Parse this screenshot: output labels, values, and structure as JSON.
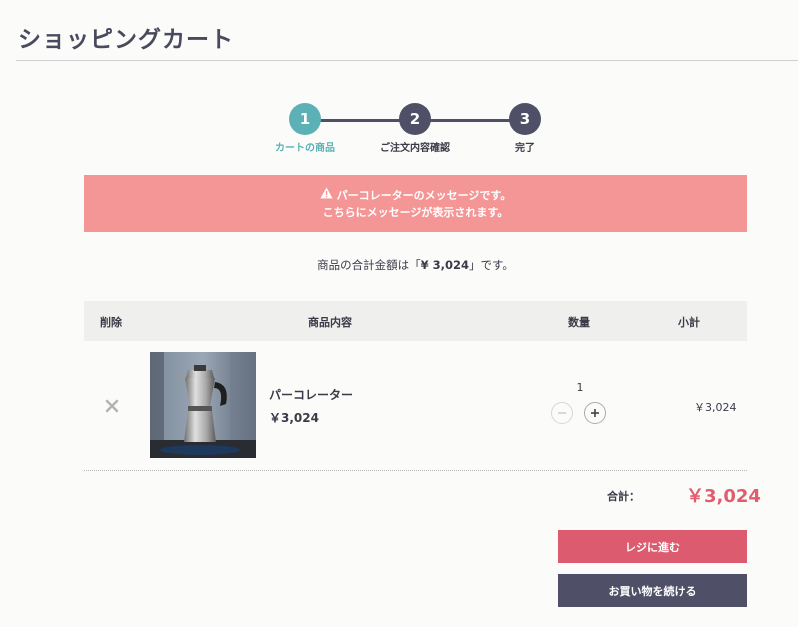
{
  "page": {
    "title": "ショッピングカート"
  },
  "steps": [
    {
      "number": "1",
      "label": "カートの商品",
      "active": true
    },
    {
      "number": "2",
      "label": "ご注文内容確認",
      "active": false
    },
    {
      "number": "3",
      "label": "完了",
      "active": false
    }
  ],
  "colors": {
    "active_step": "#5bb1b5",
    "inactive_step": "#4f4f68",
    "alert_bg": "#f59696",
    "accent_red": "#e25c6c"
  },
  "alert": {
    "icon": "warning-icon",
    "line1": "パーコレーターのメッセージです。",
    "line2": "こちらにメッセージが表示されます。"
  },
  "summary_text": {
    "prefix": "商品の合計金額は「",
    "amount": "¥ 3,024",
    "suffix": "」です。"
  },
  "table": {
    "headers": {
      "delete": "削除",
      "product": "商品内容",
      "quantity": "数量",
      "subtotal": "小計"
    },
    "items": [
      {
        "name": "パーコレーター",
        "price": "￥3,024",
        "quantity": "1",
        "subtotal": "￥3,024",
        "image": "percolator-photo"
      }
    ]
  },
  "total": {
    "label": "合計：",
    "value": "￥3,024"
  },
  "buttons": {
    "checkout": "レジに進む",
    "continue_shopping": "お買い物を続ける"
  }
}
